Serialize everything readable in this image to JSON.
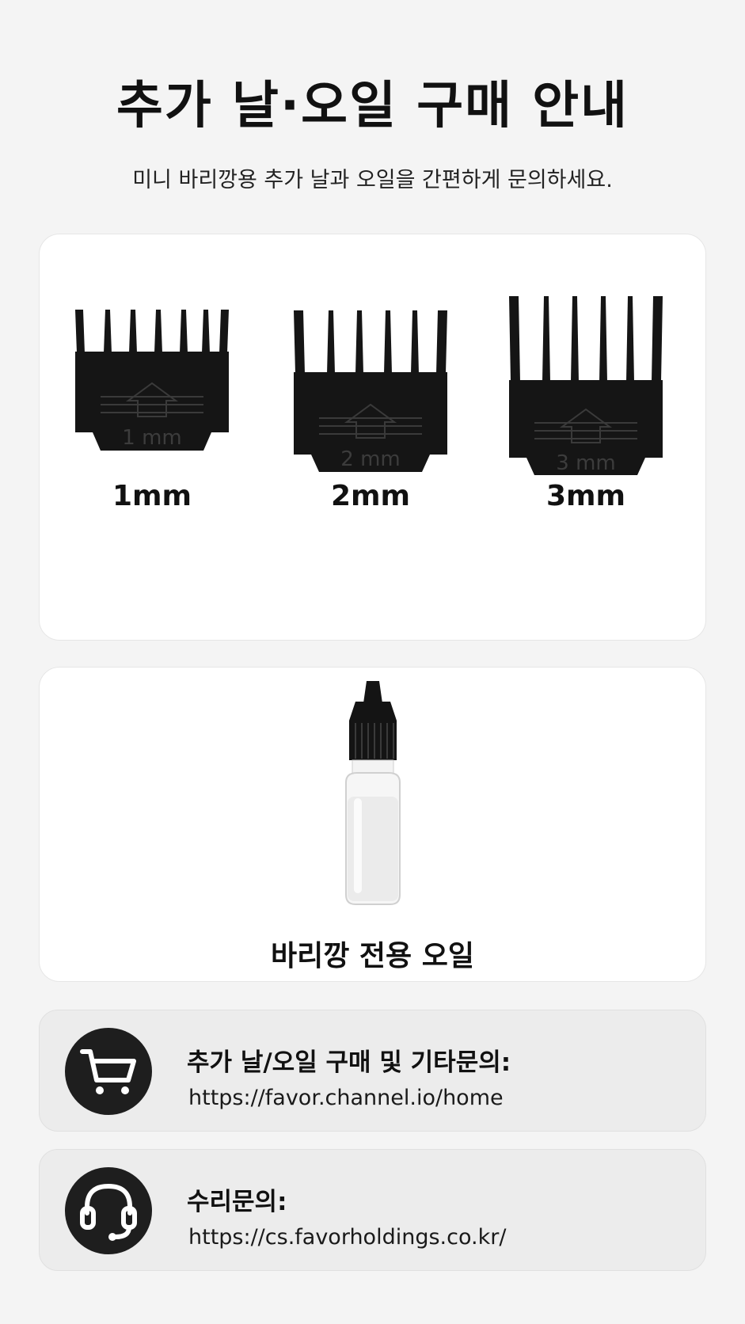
{
  "header": {
    "title": "추가 날·오일 구매 안내",
    "subtitle": "미니 바리깡용 추가 날과 오일을 간편하게 문의하세요."
  },
  "guides": [
    {
      "label": "1mm",
      "engraving": "1 mm"
    },
    {
      "label": "2mm",
      "engraving": "2 mm"
    },
    {
      "label": "3mm",
      "engraving": "3 mm"
    }
  ],
  "oil": {
    "label": "바리깡 전용 오일"
  },
  "contacts": [
    {
      "heading": "추가 날/오일 구매 및 기타문의:",
      "url": "https://favor.channel.io/home",
      "icon": "cart-icon"
    },
    {
      "heading": "수리문의:",
      "url": "https://cs.favorholdings.co.kr/",
      "icon": "headset-icon"
    }
  ],
  "colors": {
    "background": "#f4f4f4",
    "card": "#ffffff",
    "info_card": "#ececec",
    "icon_circle": "#1e1e1e"
  }
}
